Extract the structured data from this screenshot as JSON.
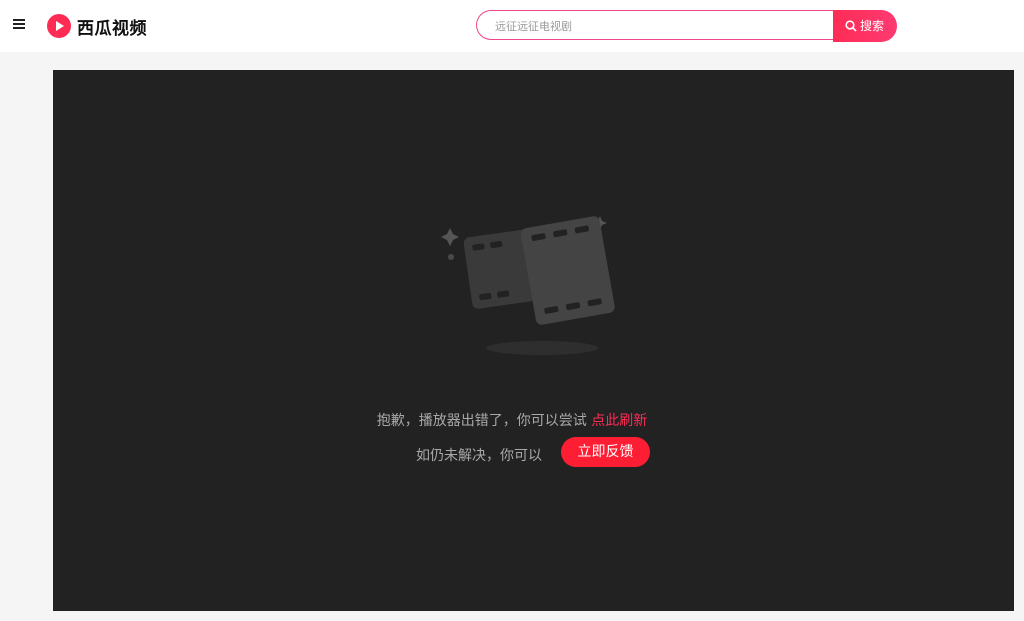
{
  "brand": {
    "name": "西瓜视频",
    "accent_color": "#fe2c55",
    "logo_icon": "xigua-play-icon"
  },
  "header": {
    "menu_icon": "hamburger-menu-icon",
    "search": {
      "placeholder": "远征远征电视剧",
      "button_label": "搜索",
      "icon": "search-icon"
    }
  },
  "player": {
    "error_message": "抱歉，播放器出错了，你可以尝试 ",
    "refresh_link": "点此刷新",
    "followup_message": "如仍未解决，你可以",
    "feedback_button": "立即反馈",
    "illustration_icon": "broken-film-icon"
  }
}
